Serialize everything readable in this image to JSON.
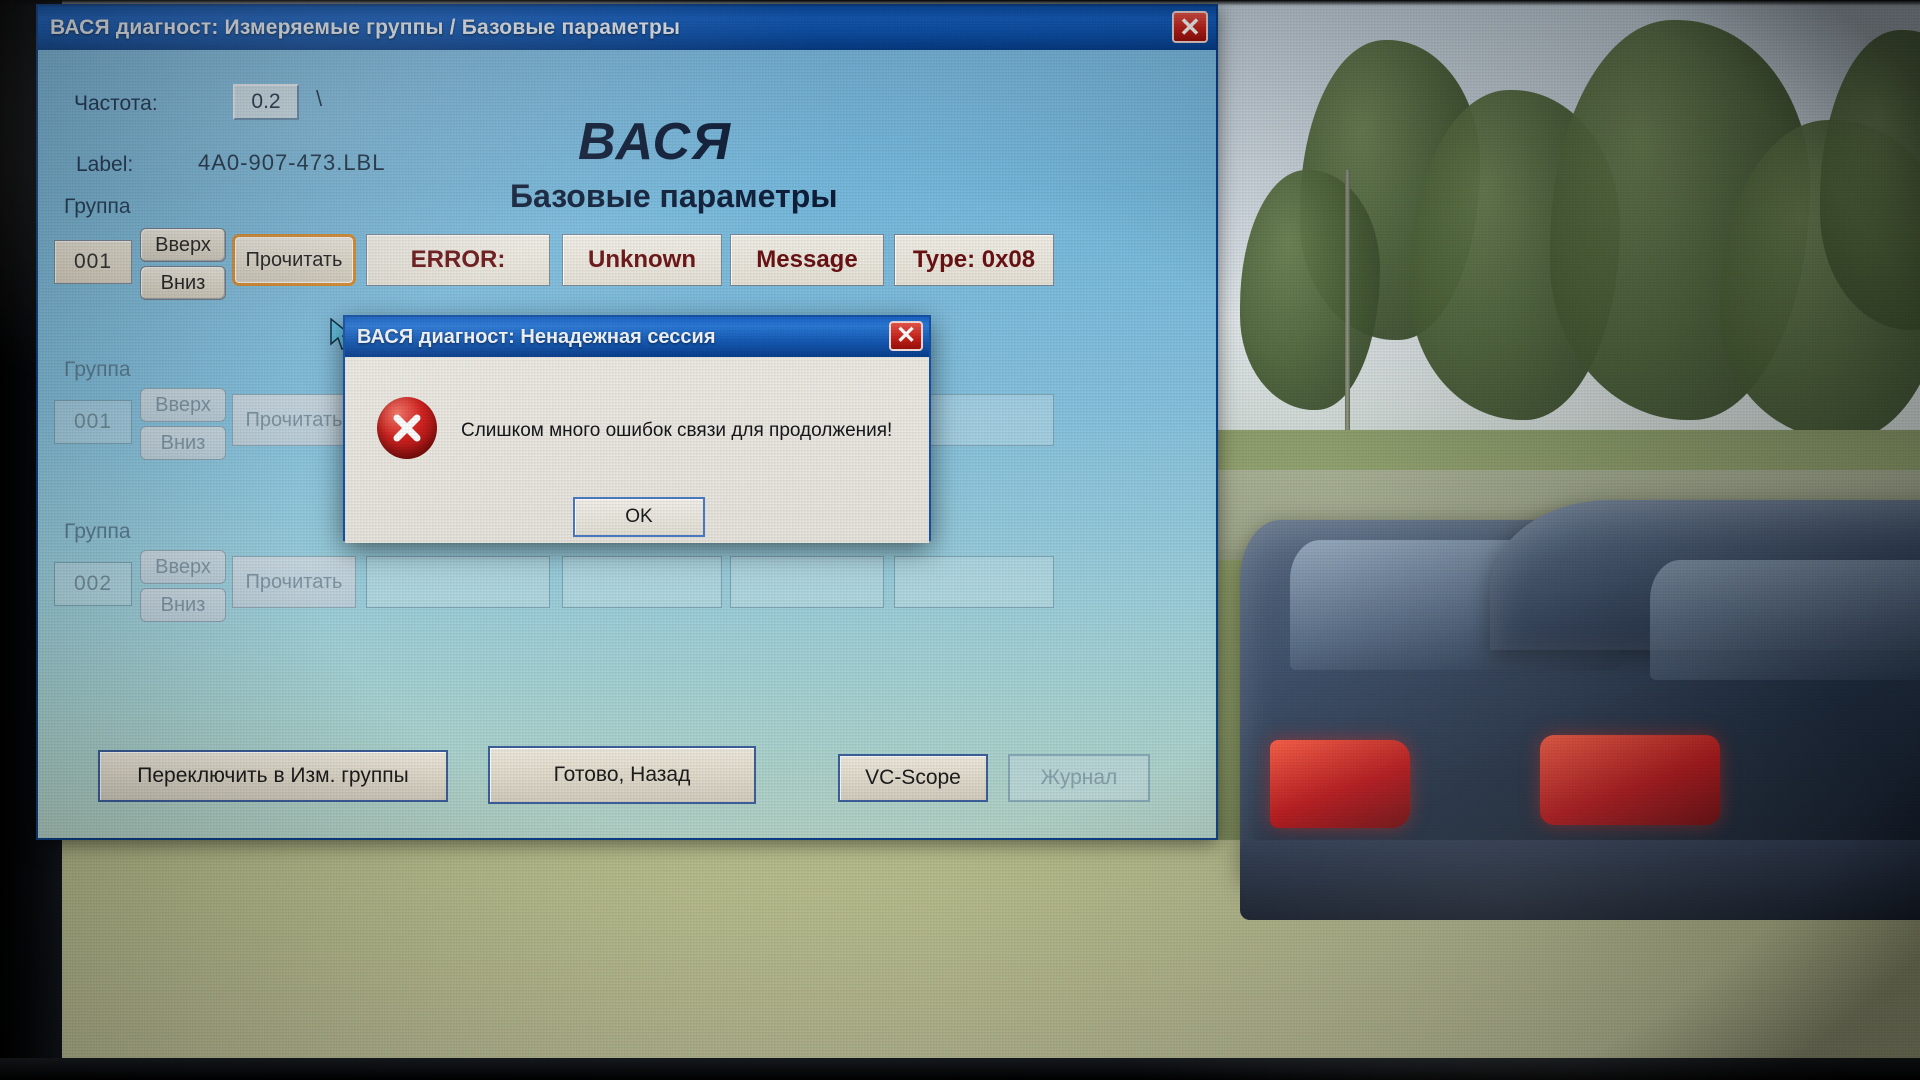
{
  "window": {
    "title": "ВАСЯ диагност: Измеряемые группы / Базовые параметры",
    "close_label": "✕"
  },
  "form": {
    "frequency_label": "Частота:",
    "frequency_value": "0.2",
    "frequency_suffix": "\\",
    "label_label": "Label:",
    "label_value": "4A0-907-473.LBL",
    "brand_title": "ВАСЯ",
    "brand_subtitle": "Базовые параметры"
  },
  "groups": [
    {
      "caption": "Группа",
      "id": "001",
      "up_label": "Вверх",
      "down_label": "Вниз",
      "read_label": "Прочитать",
      "fields": [
        "ERROR:",
        "Unknown",
        "Message",
        "Type: 0x08"
      ],
      "active": true
    },
    {
      "caption": "Группа",
      "id": "001",
      "up_label": "Вверх",
      "down_label": "Вниз",
      "read_label": "Прочитать",
      "fields": [
        "",
        "",
        "",
        ""
      ],
      "active": false
    },
    {
      "caption": "Группа",
      "id": "002",
      "up_label": "Вверх",
      "down_label": "Вниз",
      "read_label": "Прочитать",
      "fields": [
        "",
        "",
        "",
        ""
      ],
      "active": false
    }
  ],
  "footer": {
    "switch_label": "Переключить в Изм. группы",
    "done_label": "Готово, Назад",
    "scope_label": "VC-Scope",
    "journal_label": "Журнал"
  },
  "modal": {
    "title": "ВАСЯ диагност: Ненадежная сессия",
    "close_label": "✕",
    "message": "Слишком много ошибок связи для продолжения!",
    "ok_label": "OK"
  },
  "colors": {
    "titlebar_blue": "#0d55b2",
    "window_bg": "#86c2df",
    "readout_text": "#6a1113",
    "focus_orange": "#d98b2b",
    "error_red": "#c61f17"
  }
}
